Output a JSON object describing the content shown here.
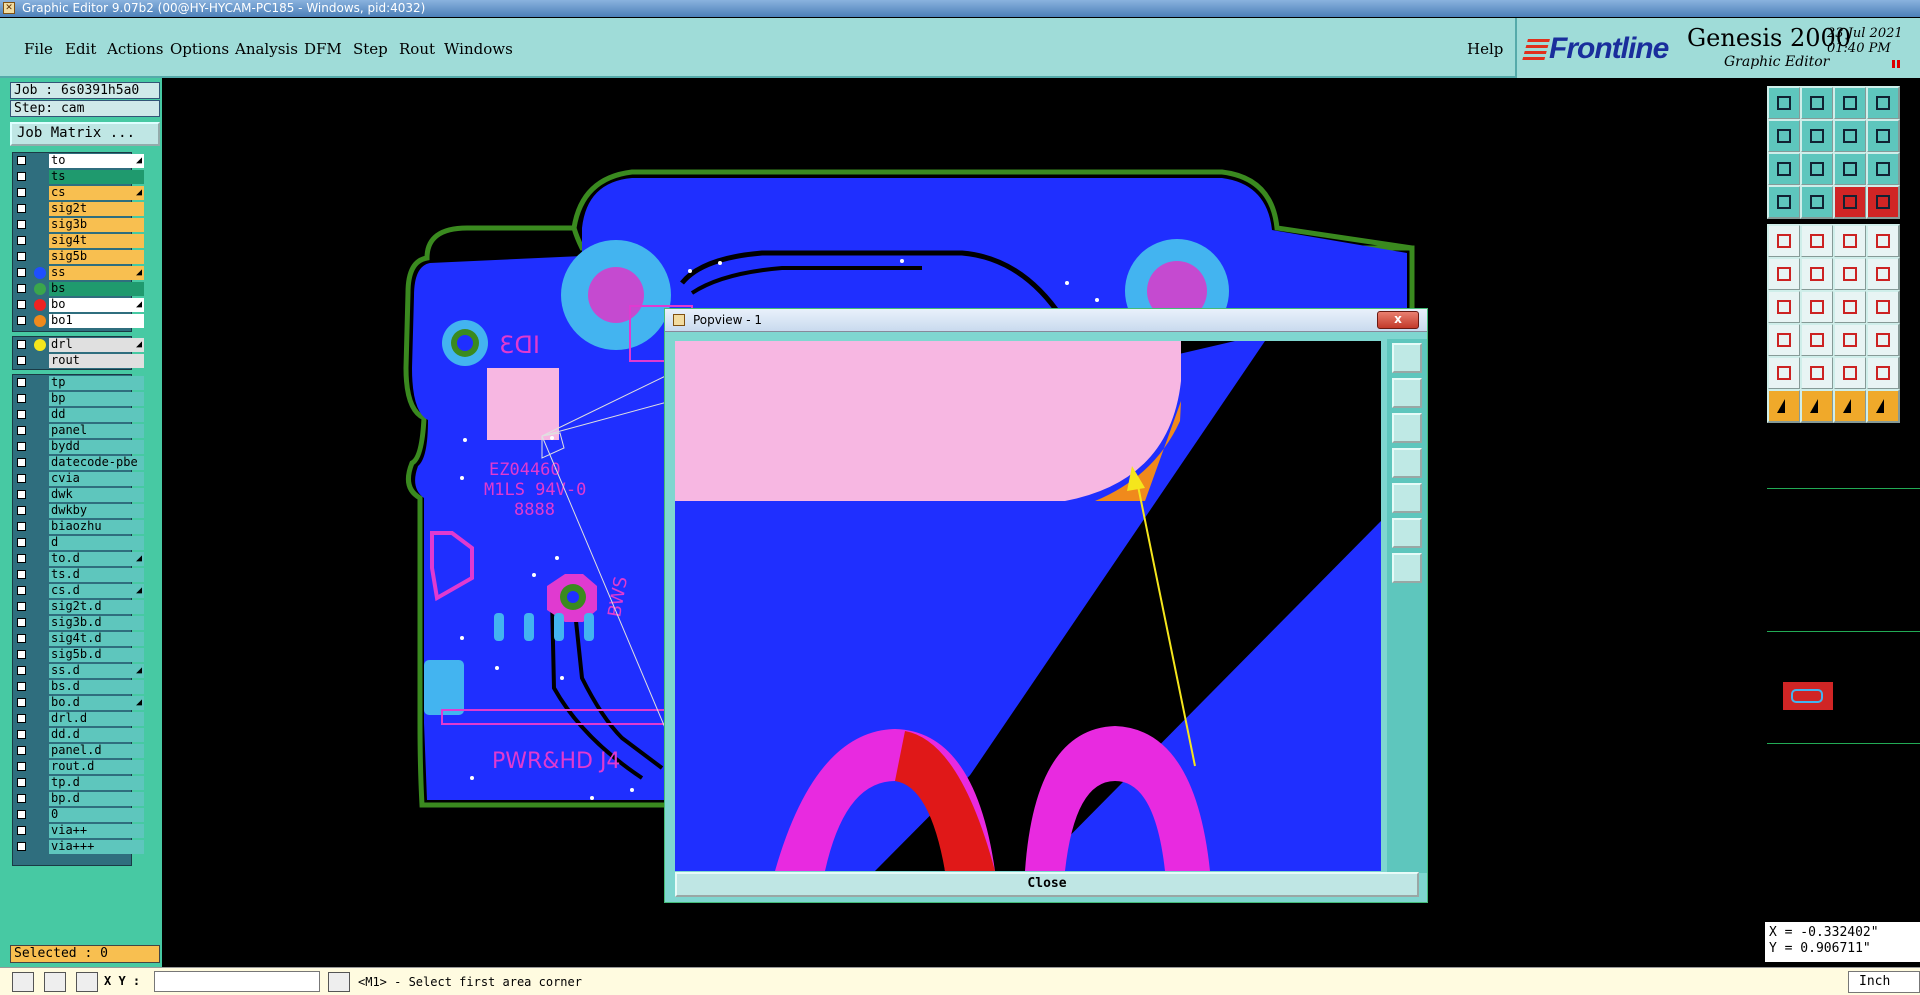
{
  "window": {
    "title": "Graphic Editor 9.07b2 (00@HY-HYCAM-PC185 - Windows, pid:4032)"
  },
  "menu": {
    "items": [
      "File",
      "Edit",
      "Actions",
      "Options",
      "Analysis",
      "DFM",
      "Step",
      "Rout",
      "Windows"
    ],
    "help": "Help"
  },
  "brand": {
    "logo": "Frontline",
    "product": "Genesis 2000",
    "subtitle": "Graphic Editor",
    "date": "23 Jul 2021",
    "time": "01:40 PM"
  },
  "left": {
    "job": "Job : 6s0391h5a0",
    "step": "Step: cam",
    "job_matrix": "Job Matrix ...",
    "selected": "Selected : 0",
    "board_layers": [
      {
        "name": "to",
        "bg": "#ffffff",
        "dot": "",
        "flag": true
      },
      {
        "name": "ts",
        "bg": "#1f9a6e",
        "dot": "",
        "flag": false
      },
      {
        "name": "cs",
        "bg": "#f8bf50",
        "dot": "",
        "flag": true
      },
      {
        "name": "sig2t",
        "bg": "#f8bf50",
        "dot": "",
        "flag": false
      },
      {
        "name": "sig3b",
        "bg": "#f8bf50",
        "dot": "",
        "flag": false
      },
      {
        "name": "sig4t",
        "bg": "#f8bf50",
        "dot": "",
        "flag": false
      },
      {
        "name": "sig5b",
        "bg": "#f8bf50",
        "dot": "",
        "flag": false
      },
      {
        "name": "ss",
        "bg": "#f8bf50",
        "dot": "#1f4fff",
        "flag": true
      },
      {
        "name": "bs",
        "bg": "#1f9a6e",
        "dot": "#3aa64b",
        "flag": false
      },
      {
        "name": "bo",
        "bg": "#ffffff",
        "dot": "#e22",
        "flag": true
      },
      {
        "name": "bo1",
        "bg": "#ffffff",
        "dot": "#f08a1c",
        "flag": false
      }
    ],
    "drill_layers": [
      {
        "name": "drl",
        "bg": "#e0e0e0",
        "dot": "#f5e61c",
        "flag": true
      },
      {
        "name": "rout",
        "bg": "#e0e0e0",
        "dot": "",
        "flag": false
      }
    ],
    "misc_layers": [
      {
        "name": "tp",
        "flag": false
      },
      {
        "name": "bp",
        "flag": false
      },
      {
        "name": "dd",
        "flag": false
      },
      {
        "name": "panel",
        "flag": false
      },
      {
        "name": "bydd",
        "flag": false
      },
      {
        "name": "datecode-pbe",
        "flag": false
      },
      {
        "name": "cvia",
        "flag": false
      },
      {
        "name": "dwk",
        "flag": false
      },
      {
        "name": "dwkby",
        "flag": false
      },
      {
        "name": "biaozhu",
        "flag": false
      },
      {
        "name": "d",
        "flag": false
      },
      {
        "name": "to.d",
        "flag": true
      },
      {
        "name": "ts.d",
        "flag": false
      },
      {
        "name": "cs.d",
        "flag": true
      },
      {
        "name": "sig2t.d",
        "flag": false
      },
      {
        "name": "sig3b.d",
        "flag": false
      },
      {
        "name": "sig4t.d",
        "flag": false
      },
      {
        "name": "sig5b.d",
        "flag": false
      },
      {
        "name": "ss.d",
        "flag": true
      },
      {
        "name": "bs.d",
        "flag": false
      },
      {
        "name": "bo.d",
        "flag": true
      },
      {
        "name": "drl.d",
        "flag": false
      },
      {
        "name": "dd.d",
        "flag": false
      },
      {
        "name": "panel.d",
        "flag": false
      },
      {
        "name": "rout.d",
        "flag": false
      },
      {
        "name": "tp.d",
        "flag": false
      },
      {
        "name": "bp.d",
        "flag": false
      },
      {
        "name": "0",
        "flag": false
      },
      {
        "name": "via++",
        "flag": false
      },
      {
        "name": "via+++",
        "flag": false
      }
    ]
  },
  "canvas": {
    "board_texts": [
      "ID3",
      "EZ04460",
      "M1LS 94V-0",
      "8888",
      "BWS",
      "PWR&HD J4"
    ],
    "colors": {
      "board": "#1f2fff",
      "outline": "#3a8a1f",
      "pad_light": "#43b4f0",
      "pad_magenta": "#c54ad0",
      "silk": "#e03ad0"
    }
  },
  "popview": {
    "title": "Popview - 1",
    "close_x": "x",
    "close_button": "Close"
  },
  "coords": {
    "x": "X = -0.332402\"",
    "y": "Y = 0.906711\""
  },
  "status": {
    "xy_label": "X Y :",
    "xy_value": "",
    "prompt": "<M1> - Select first area corner",
    "unit": "Inch"
  },
  "icons": {
    "right_toolbar": [
      "layer-up-icon",
      "layer-down-icon",
      "home-icon",
      "split-view-icon",
      "zoom-left-icon",
      "zoom-right-icon",
      "one-to-one-icon",
      "scale-icon",
      "fit-icon",
      "center-icon",
      "ratio-icon",
      "help-icon",
      "snap-icon",
      "grid-icon",
      "net-icon",
      "net2-icon",
      "pad-icon",
      "angle-icon",
      "measure-icon",
      "dot-icon",
      "connect-icon",
      "cross-icon",
      "probe-icon",
      "line-icon",
      "angle-tool-icon",
      "diagonal-icon",
      "arc-icon",
      "text-icon",
      "node-icon",
      "minus-icon",
      "dimension-icon",
      "calc-icon",
      "triangle-icon",
      "triangle2-icon",
      "triangle3-icon",
      "triangle4-icon",
      "select-arrow-icon",
      "select-plus-icon",
      "select-move-icon",
      "select-route-icon"
    ],
    "popview_side": [
      "zoom-area-icon",
      "layer-up-icon",
      "layer-down-icon",
      "zoom-left-icon",
      "zoom-right-icon",
      "fit-icon",
      "center-icon"
    ]
  }
}
